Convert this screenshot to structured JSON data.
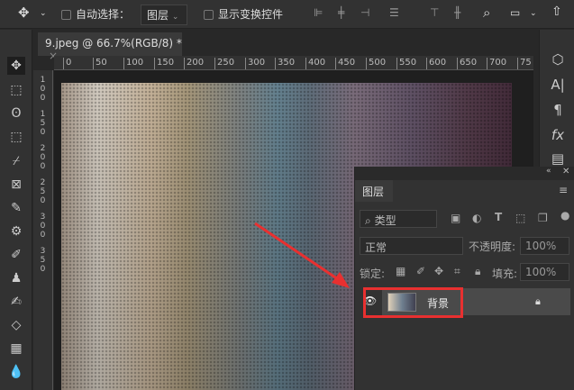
{
  "options_bar": {
    "auto_select_label": "自动选择：",
    "auto_select_target": "图层",
    "show_transform_label": "显示变换控件"
  },
  "document_tab": {
    "title": "9.jpeg @ 66.7%(RGB/8) *",
    "close": "×"
  },
  "ruler": {
    "h_ticks": [
      "0",
      "50",
      "100",
      "150",
      "200",
      "250",
      "300",
      "350",
      "400",
      "450",
      "500",
      "550",
      "600",
      "650",
      "700",
      "75"
    ],
    "v_ticks": [
      "1",
      "0",
      "0",
      "1",
      "5",
      "0",
      "2",
      "0",
      "0",
      "2",
      "5",
      "0",
      "3",
      "0",
      "0",
      "3",
      "5",
      "0"
    ]
  },
  "layers_panel": {
    "tab": "图层",
    "filter_kind": "类型",
    "blend_mode": "正常",
    "opacity_label": "不透明度:",
    "opacity": "100%",
    "lock_label": "锁定:",
    "fill_label": "填充:",
    "fill": "100%",
    "layers": [
      {
        "name": "背景",
        "visible": true,
        "locked": true
      }
    ]
  },
  "annotation": {
    "arrow_color": "#e83030",
    "highlight_color": "#e83030"
  }
}
